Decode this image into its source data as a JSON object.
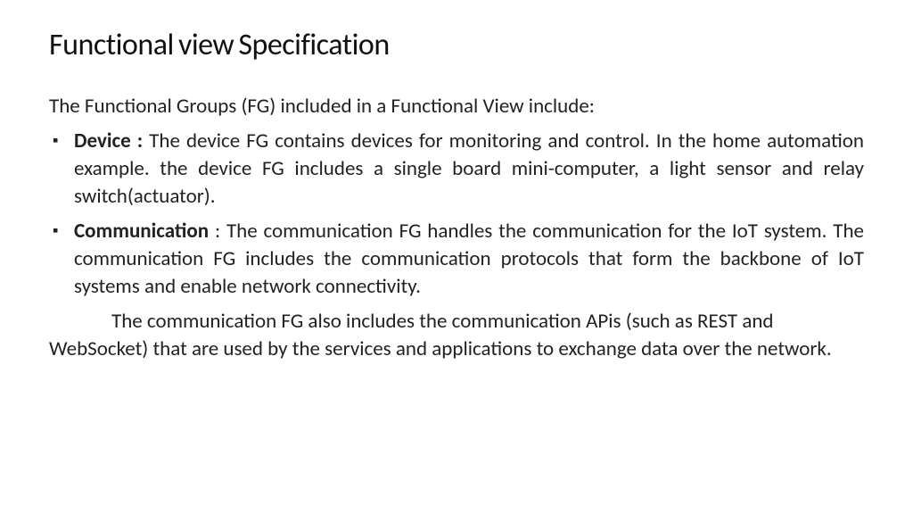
{
  "title": "Functional view Specification",
  "intro": "The Functional Groups (FG) included in a Functional View include:",
  "bullets": [
    {
      "label": "Device : ",
      "text": "The device FG contains devices for monitoring and control. In  the home automation example. the device FG includes a single board  mini-computer, a light sensor and relay switch(actuator)."
    },
    {
      "label": "Communication",
      "text": " : The communication  FG handles the communication  for the IoT system. The communication FG includes  the communication protocols that form the backbone of IoT systems  and enable network connectivity."
    }
  ],
  "para": "The communication FG also includes the communication APis  (such as REST and WebSocket) that are used by the services and  applications to exchange data over the network."
}
